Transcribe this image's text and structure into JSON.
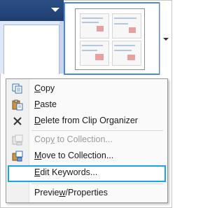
{
  "menu": {
    "items": [
      {
        "id": "copy",
        "accel": "C",
        "rest": "opy",
        "icon": "copy-icon",
        "enabled": true
      },
      {
        "id": "paste",
        "accel": "P",
        "rest": "aste",
        "icon": "paste-icon",
        "enabled": true
      },
      {
        "id": "delete",
        "accel": "D",
        "rest": "elete from Clip Organizer",
        "icon": "delete-x-icon",
        "enabled": true
      },
      {
        "id": "copy-to-collection",
        "pre": "Cop",
        "accel": "y",
        "rest": " to Collection...",
        "icon": "copy-to-collection-icon",
        "enabled": false
      },
      {
        "id": "move-to-collection",
        "accel": "M",
        "rest": "ove to Collection...",
        "icon": "move-to-collection-icon",
        "enabled": true
      },
      {
        "id": "edit-keywords",
        "accel": "E",
        "rest": "dit Keywords...",
        "icon": "",
        "enabled": true,
        "highlighted": true
      },
      {
        "id": "preview-properties",
        "pre": "Previe",
        "accel": "w",
        "rest": "/Properties",
        "icon": "",
        "enabled": true
      }
    ]
  },
  "colors": {
    "highlight_border": "#1aa6e6",
    "thumbnail_border": "#4a8ad9",
    "pane_header": "#1f3e6f"
  }
}
